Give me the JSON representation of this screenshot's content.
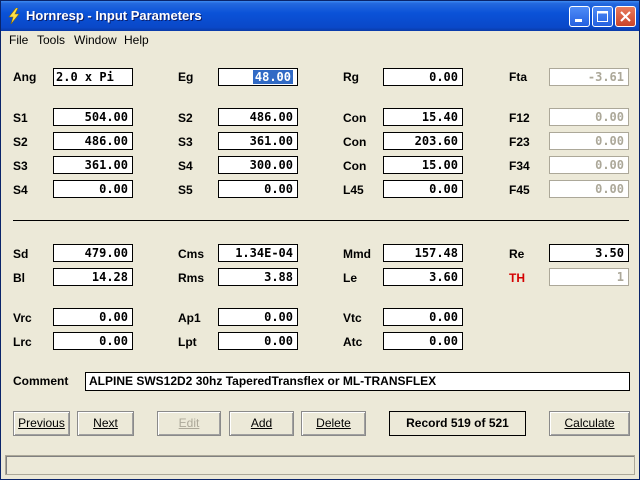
{
  "window": {
    "title": "Hornresp - Input Parameters"
  },
  "menu": [
    "File",
    "Tools",
    "Window",
    "Help"
  ],
  "fields": {
    "ang": {
      "label": "Ang",
      "value": "2.0 x Pi"
    },
    "eg": {
      "label": "Eg",
      "value": "48.00"
    },
    "rg": {
      "label": "Rg",
      "value": "0.00"
    },
    "fta": {
      "label": "Fta",
      "value": "-3.61"
    },
    "s1a": {
      "label": "S1",
      "value": "504.00"
    },
    "s2a": {
      "label": "S2",
      "value": "486.00"
    },
    "con1": {
      "label": "Con",
      "value": "15.40"
    },
    "f12": {
      "label": "F12",
      "value": "0.00"
    },
    "s2b": {
      "label": "S2",
      "value": "486.00"
    },
    "s3a": {
      "label": "S3",
      "value": "361.00"
    },
    "con2": {
      "label": "Con",
      "value": "203.60"
    },
    "f23": {
      "label": "F23",
      "value": "0.00"
    },
    "s3b": {
      "label": "S3",
      "value": "361.00"
    },
    "s4a": {
      "label": "S4",
      "value": "300.00"
    },
    "con3": {
      "label": "Con",
      "value": "15.00"
    },
    "f34": {
      "label": "F34",
      "value": "0.00"
    },
    "s4b": {
      "label": "S4",
      "value": "0.00"
    },
    "s5": {
      "label": "S5",
      "value": "0.00"
    },
    "l45": {
      "label": "L45",
      "value": "0.00"
    },
    "f45": {
      "label": "F45",
      "value": "0.00"
    },
    "sd": {
      "label": "Sd",
      "value": "479.00"
    },
    "cms": {
      "label": "Cms",
      "value": "1.34E-04"
    },
    "mmd": {
      "label": "Mmd",
      "value": "157.48"
    },
    "re": {
      "label": "Re",
      "value": "3.50"
    },
    "bl": {
      "label": "Bl",
      "value": "14.28"
    },
    "rms": {
      "label": "Rms",
      "value": "3.88"
    },
    "le": {
      "label": "Le",
      "value": "3.60"
    },
    "th": {
      "label": "TH",
      "value": "1"
    },
    "vrc": {
      "label": "Vrc",
      "value": "0.00"
    },
    "ap1": {
      "label": "Ap1",
      "value": "0.00"
    },
    "vtc": {
      "label": "Vtc",
      "value": "0.00"
    },
    "lrc": {
      "label": "Lrc",
      "value": "0.00"
    },
    "lpt": {
      "label": "Lpt",
      "value": "0.00"
    },
    "atc": {
      "label": "Atc",
      "value": "0.00"
    }
  },
  "comment": {
    "label": "Comment",
    "value": "ALPINE SWS12D2 30hz TaperedTransflex or ML-TRANSFLEX"
  },
  "buttons": {
    "previous": "Previous",
    "next": "Next",
    "edit": "Edit",
    "add": "Add",
    "delete": "Delete",
    "calculate": "Calculate"
  },
  "record": "Record 519 of 521",
  "colors": {
    "titlebar": "#0a52d8",
    "selection": "#316ac5",
    "th_label": "#d40000",
    "disabled": "#aca899"
  }
}
